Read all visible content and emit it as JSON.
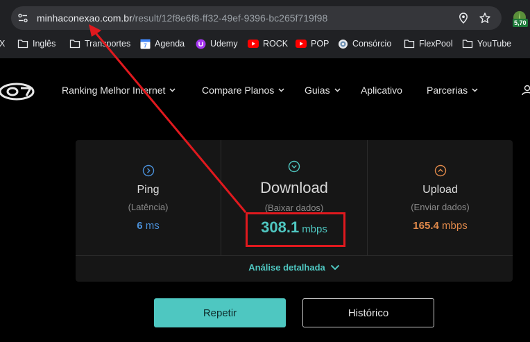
{
  "browser": {
    "url_host": "minhaconexao.com.br",
    "url_path": "/result/12f8e6f8-ff32-49ef-9396-bc265f719f98",
    "extension_badge": "5,70",
    "bookmarks": [
      {
        "label": "X",
        "icon": "folder-icon"
      },
      {
        "label": "Inglês",
        "icon": "folder-icon"
      },
      {
        "label": "Transportes",
        "icon": "folder-icon"
      },
      {
        "label": "Agenda",
        "icon": "calendar-icon"
      },
      {
        "label": "Udemy",
        "icon": "udemy-icon"
      },
      {
        "label": "ROCK",
        "icon": "youtube-icon"
      },
      {
        "label": "POP",
        "icon": "youtube-icon"
      },
      {
        "label": "Consórcio",
        "icon": "globe-icon"
      },
      {
        "label": "FlexPool",
        "icon": "folder-icon"
      },
      {
        "label": "YouTube",
        "icon": "folder-icon"
      }
    ]
  },
  "nav": {
    "items": [
      {
        "label": "Ranking Melhor Internet",
        "has_dropdown": true
      },
      {
        "label": "Compare Planos",
        "has_dropdown": true
      },
      {
        "label": "Guias",
        "has_dropdown": true
      },
      {
        "label": "Aplicativo",
        "has_dropdown": false
      },
      {
        "label": "Parcerias",
        "has_dropdown": true
      }
    ]
  },
  "results": {
    "ping": {
      "title": "Ping",
      "subtitle": "(Latência)",
      "value": "6",
      "unit": "ms",
      "color": "#4a90d9"
    },
    "download": {
      "title": "Download",
      "subtitle": "(Baixar dados)",
      "value": "308.1",
      "unit": "mbps",
      "color": "#4fc7c1"
    },
    "upload": {
      "title": "Upload",
      "subtitle": "(Enviar dados)",
      "value": "165.4",
      "unit": "mbps",
      "color": "#e0894a"
    },
    "analysis_label": "Análise detalhada"
  },
  "actions": {
    "repeat_label": "Repetir",
    "history_label": "Histórico"
  },
  "colors": {
    "accent": "#4fc7c1",
    "annotation": "#e0191e"
  }
}
